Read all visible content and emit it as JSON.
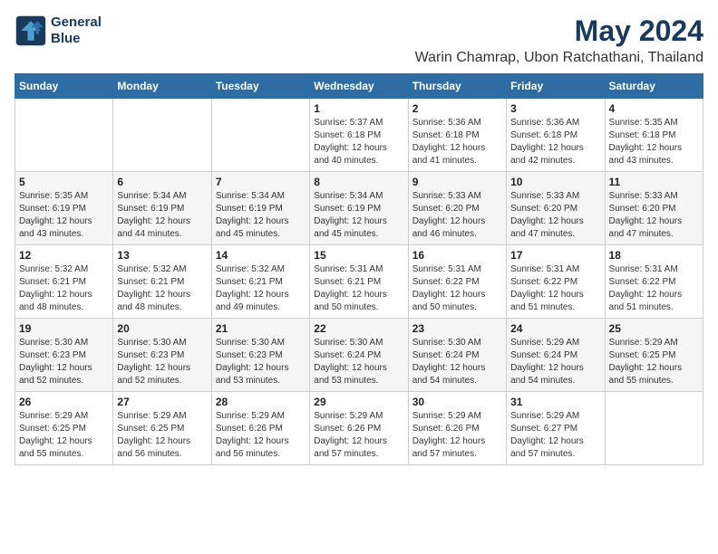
{
  "header": {
    "logo_line1": "General",
    "logo_line2": "Blue",
    "title": "May 2024",
    "subtitle": "Warin Chamrap, Ubon Ratchathani, Thailand"
  },
  "calendar": {
    "weekdays": [
      "Sunday",
      "Monday",
      "Tuesday",
      "Wednesday",
      "Thursday",
      "Friday",
      "Saturday"
    ],
    "rows": [
      [
        {
          "day": "",
          "info": ""
        },
        {
          "day": "",
          "info": ""
        },
        {
          "day": "",
          "info": ""
        },
        {
          "day": "1",
          "info": "Sunrise: 5:37 AM\nSunset: 6:18 PM\nDaylight: 12 hours\nand 40 minutes."
        },
        {
          "day": "2",
          "info": "Sunrise: 5:36 AM\nSunset: 6:18 PM\nDaylight: 12 hours\nand 41 minutes."
        },
        {
          "day": "3",
          "info": "Sunrise: 5:36 AM\nSunset: 6:18 PM\nDaylight: 12 hours\nand 42 minutes."
        },
        {
          "day": "4",
          "info": "Sunrise: 5:35 AM\nSunset: 6:18 PM\nDaylight: 12 hours\nand 43 minutes."
        }
      ],
      [
        {
          "day": "5",
          "info": "Sunrise: 5:35 AM\nSunset: 6:19 PM\nDaylight: 12 hours\nand 43 minutes."
        },
        {
          "day": "6",
          "info": "Sunrise: 5:34 AM\nSunset: 6:19 PM\nDaylight: 12 hours\nand 44 minutes."
        },
        {
          "day": "7",
          "info": "Sunrise: 5:34 AM\nSunset: 6:19 PM\nDaylight: 12 hours\nand 45 minutes."
        },
        {
          "day": "8",
          "info": "Sunrise: 5:34 AM\nSunset: 6:19 PM\nDaylight: 12 hours\nand 45 minutes."
        },
        {
          "day": "9",
          "info": "Sunrise: 5:33 AM\nSunset: 6:20 PM\nDaylight: 12 hours\nand 46 minutes."
        },
        {
          "day": "10",
          "info": "Sunrise: 5:33 AM\nSunset: 6:20 PM\nDaylight: 12 hours\nand 47 minutes."
        },
        {
          "day": "11",
          "info": "Sunrise: 5:33 AM\nSunset: 6:20 PM\nDaylight: 12 hours\nand 47 minutes."
        }
      ],
      [
        {
          "day": "12",
          "info": "Sunrise: 5:32 AM\nSunset: 6:21 PM\nDaylight: 12 hours\nand 48 minutes."
        },
        {
          "day": "13",
          "info": "Sunrise: 5:32 AM\nSunset: 6:21 PM\nDaylight: 12 hours\nand 48 minutes."
        },
        {
          "day": "14",
          "info": "Sunrise: 5:32 AM\nSunset: 6:21 PM\nDaylight: 12 hours\nand 49 minutes."
        },
        {
          "day": "15",
          "info": "Sunrise: 5:31 AM\nSunset: 6:21 PM\nDaylight: 12 hours\nand 50 minutes."
        },
        {
          "day": "16",
          "info": "Sunrise: 5:31 AM\nSunset: 6:22 PM\nDaylight: 12 hours\nand 50 minutes."
        },
        {
          "day": "17",
          "info": "Sunrise: 5:31 AM\nSunset: 6:22 PM\nDaylight: 12 hours\nand 51 minutes."
        },
        {
          "day": "18",
          "info": "Sunrise: 5:31 AM\nSunset: 6:22 PM\nDaylight: 12 hours\nand 51 minutes."
        }
      ],
      [
        {
          "day": "19",
          "info": "Sunrise: 5:30 AM\nSunset: 6:23 PM\nDaylight: 12 hours\nand 52 minutes."
        },
        {
          "day": "20",
          "info": "Sunrise: 5:30 AM\nSunset: 6:23 PM\nDaylight: 12 hours\nand 52 minutes."
        },
        {
          "day": "21",
          "info": "Sunrise: 5:30 AM\nSunset: 6:23 PM\nDaylight: 12 hours\nand 53 minutes."
        },
        {
          "day": "22",
          "info": "Sunrise: 5:30 AM\nSunset: 6:24 PM\nDaylight: 12 hours\nand 53 minutes."
        },
        {
          "day": "23",
          "info": "Sunrise: 5:30 AM\nSunset: 6:24 PM\nDaylight: 12 hours\nand 54 minutes."
        },
        {
          "day": "24",
          "info": "Sunrise: 5:29 AM\nSunset: 6:24 PM\nDaylight: 12 hours\nand 54 minutes."
        },
        {
          "day": "25",
          "info": "Sunrise: 5:29 AM\nSunset: 6:25 PM\nDaylight: 12 hours\nand 55 minutes."
        }
      ],
      [
        {
          "day": "26",
          "info": "Sunrise: 5:29 AM\nSunset: 6:25 PM\nDaylight: 12 hours\nand 55 minutes."
        },
        {
          "day": "27",
          "info": "Sunrise: 5:29 AM\nSunset: 6:25 PM\nDaylight: 12 hours\nand 56 minutes."
        },
        {
          "day": "28",
          "info": "Sunrise: 5:29 AM\nSunset: 6:26 PM\nDaylight: 12 hours\nand 56 minutes."
        },
        {
          "day": "29",
          "info": "Sunrise: 5:29 AM\nSunset: 6:26 PM\nDaylight: 12 hours\nand 57 minutes."
        },
        {
          "day": "30",
          "info": "Sunrise: 5:29 AM\nSunset: 6:26 PM\nDaylight: 12 hours\nand 57 minutes."
        },
        {
          "day": "31",
          "info": "Sunrise: 5:29 AM\nSunset: 6:27 PM\nDaylight: 12 hours\nand 57 minutes."
        },
        {
          "day": "",
          "info": ""
        }
      ]
    ]
  }
}
